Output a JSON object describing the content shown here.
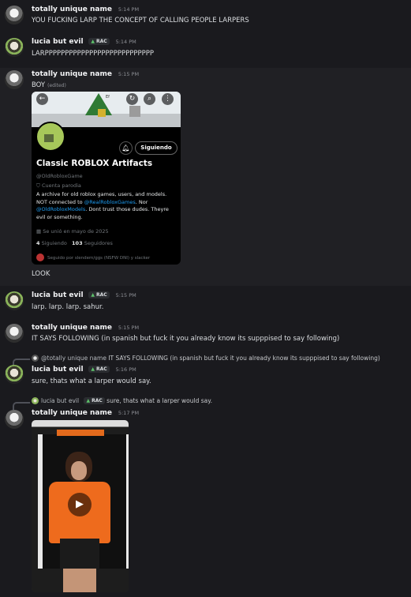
{
  "users": {
    "unique": "totally unique name",
    "lucia": "lucia but evil",
    "tag": "RAC",
    "tag_icon": "green-triangle-icon"
  },
  "messages": [
    {
      "time": "5:14 PM",
      "text": "YOU FUCKING LARP THE CONCEPT OF CALLING PEOPLE LARPERS"
    },
    {
      "time": "5:14 PM",
      "text": "LARPPPPPPPPPPPPPPPPPPPPPPPPPPP"
    },
    {
      "time": "5:15 PM",
      "text": "BOY",
      "edited": "(edited)"
    },
    {
      "text": "LOOK"
    },
    {
      "time": "5:15 PM",
      "text": "larp. larp. larp. sahur."
    },
    {
      "time": "5:15 PM",
      "text": "IT SAYS FOLLOWING (in spanish but fuck it you already know its supppised to say following)"
    },
    {
      "time": "5:16 PM",
      "text": "sure, thats what a larper would say.",
      "reply_name": "@totally unique name",
      "reply_text": "IT SAYS FOLLOWING (in spanish but fuck it you already know its supppised to say following)"
    },
    {
      "time": "5:17 PM",
      "reply_name": "lucia but evil",
      "reply_tag": "RAC",
      "reply_text": "sure, thats what a larper would say."
    }
  ],
  "embed": {
    "follow_button": "Siguiendo",
    "title": "Classic ROBLOX Artifacts",
    "handle": "@OldRobloxGame",
    "parody": "Cuenta parodia",
    "bio_1": "A archive for old roblox games, users, and models. NOT connected to ",
    "bio_link_1": "@RealRobloxGames",
    "bio_2": ". Nor ",
    "bio_link_2": "@OldRobloxModels",
    "bio_3": ". Dont trust those dudes. Theyre evil or something.",
    "joined": "Se unió en mayo de 2025",
    "following_count": "4",
    "following_label": "Siguiendo",
    "followers_count": "103",
    "followers_label": "Seguidores",
    "followed_by": "Seguido por slendem/ggs (NSFW DNI) y slacker",
    "banner_text": "Ef"
  },
  "colors": {
    "background": "#1a1a1e",
    "highlight": "#202024",
    "link": "#1d9bf0",
    "tag_green": "#5ec26b"
  }
}
